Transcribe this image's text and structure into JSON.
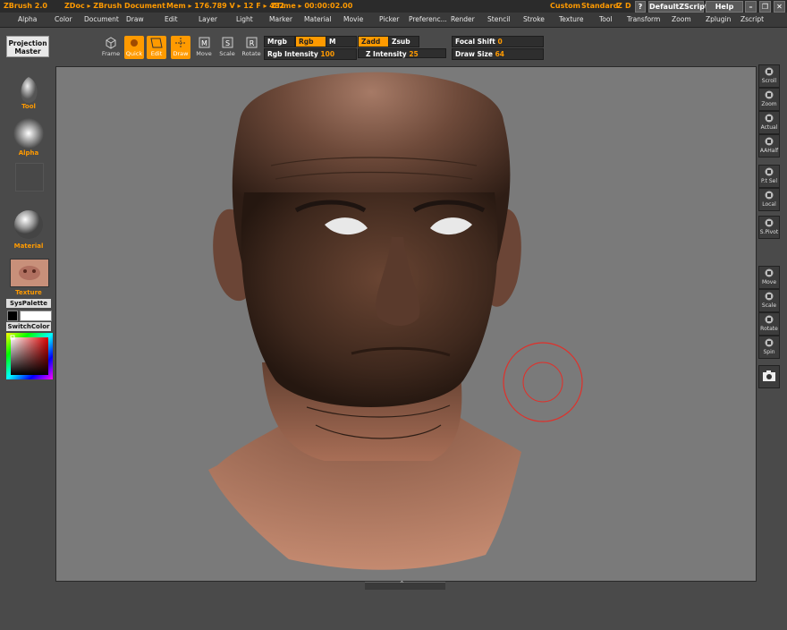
{
  "titlebar": {
    "app": "ZBrush 2.0",
    "doc": "ZDoc ▸ ZBrush Document",
    "mem": "Mem ▸ 176.789  V ▸ 12  F ▸ 482",
    "ztime": "ZTime ▸ 00:00:02.00",
    "custom": "Custom",
    "standard": "Standard",
    "z": "Z",
    "d": "D",
    "question": "?",
    "script": "DefaultZScript",
    "help": "Help"
  },
  "menu": [
    "Alpha",
    "Color",
    "Document",
    "Draw",
    "Edit",
    "Layer",
    "Light",
    "Marker",
    "Material",
    "Movie",
    "Picker",
    "Preferenc...",
    "Render",
    "Stencil",
    "Stroke",
    "Texture",
    "Tool",
    "Transform",
    "Zoom",
    "Zplugin",
    "Zscript"
  ],
  "toolbar": {
    "projection_master": [
      "Projection",
      "Master"
    ],
    "frame": "Frame",
    "quick": "Quick",
    "edit": "Edit",
    "draw": "Draw",
    "move": "Move",
    "scale": "Scale",
    "rotate": "Rotate",
    "mrgb": "Mrgb",
    "rgb": "Rgb",
    "m": "M",
    "zadd": "Zadd",
    "zsub": "Zsub",
    "focal_label": "Focal Shift",
    "focal_value": "0",
    "rgb_int_label": "Rgb Intensity",
    "rgb_int_value": "100",
    "z_int_label": "Z Intensity",
    "z_int_value": "25",
    "draw_size_label": "Draw Size",
    "draw_size_value": "64"
  },
  "left": {
    "tool": "Tool",
    "alpha": "Alpha",
    "material": "Material",
    "texture": "Texture",
    "syspalette": "SysPalette",
    "switchcolor": "SwitchColor"
  },
  "right": [
    "Scroll",
    "Zoom",
    "Actual",
    "AAHalf",
    "P.t Sel",
    "Local",
    "S.Pivot",
    "Move",
    "Scale",
    "Rotate",
    "Spin"
  ],
  "colors": {
    "accent": "#ff9a00",
    "viewport": "#7a7a7a",
    "brush_ring": "#e0302a",
    "skin": "#8a5a44"
  }
}
